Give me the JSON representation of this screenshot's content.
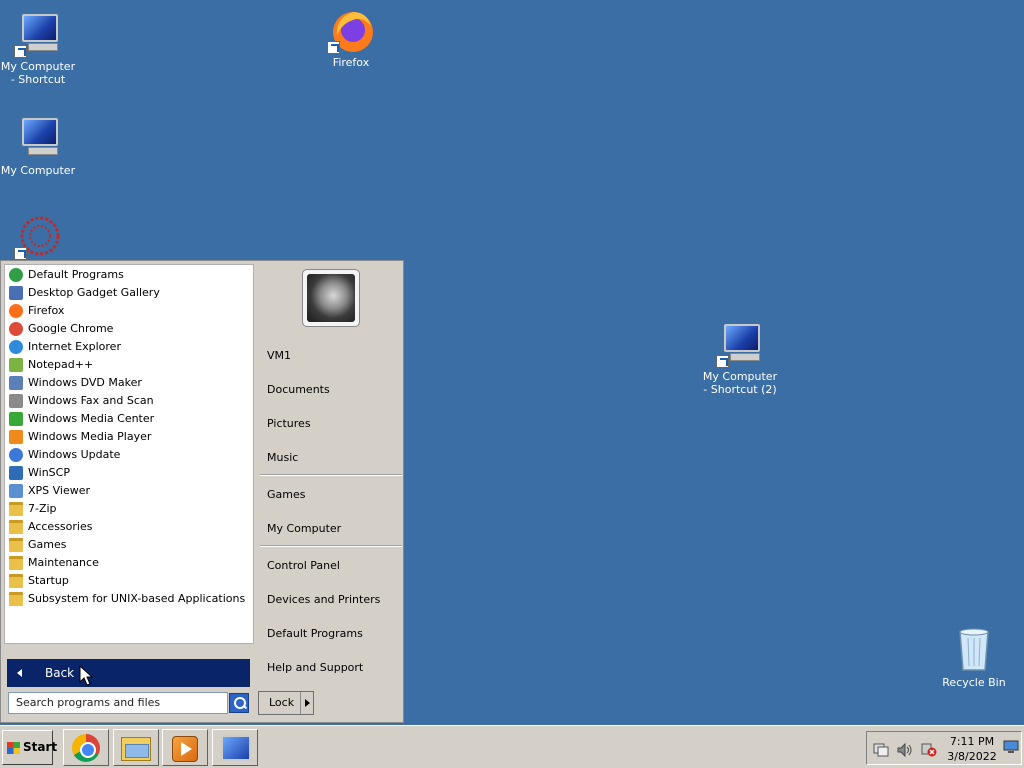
{
  "desktop": {
    "icons": [
      {
        "label": "My Computer - Shortcut"
      },
      {
        "label": "Firefox"
      },
      {
        "label": "My Computer"
      },
      {
        "label": "My Computer - Shortcut (2)"
      },
      {
        "label": "Recycle Bin"
      }
    ]
  },
  "start_menu": {
    "programs": [
      {
        "label": "Default Programs",
        "icon": "default-programs-icon"
      },
      {
        "label": "Desktop Gadget Gallery",
        "icon": "gadget-gallery-icon"
      },
      {
        "label": "Firefox",
        "icon": "firefox-icon"
      },
      {
        "label": "Google Chrome",
        "icon": "chrome-icon"
      },
      {
        "label": "Internet Explorer",
        "icon": "internet-explorer-icon"
      },
      {
        "label": "Notepad++",
        "icon": "notepadpp-icon"
      },
      {
        "label": "Windows DVD Maker",
        "icon": "dvd-maker-icon"
      },
      {
        "label": "Windows Fax and Scan",
        "icon": "fax-scan-icon"
      },
      {
        "label": "Windows Media Center",
        "icon": "media-center-icon"
      },
      {
        "label": "Windows Media Player",
        "icon": "media-player-icon"
      },
      {
        "label": "Windows Update",
        "icon": "windows-update-icon"
      },
      {
        "label": "WinSCP",
        "icon": "winscp-icon"
      },
      {
        "label": "XPS Viewer",
        "icon": "xps-viewer-icon"
      },
      {
        "label": "7-Zip",
        "icon": "folder-icon"
      },
      {
        "label": "Accessories",
        "icon": "folder-icon"
      },
      {
        "label": "Games",
        "icon": "folder-icon"
      },
      {
        "label": "Maintenance",
        "icon": "folder-icon"
      },
      {
        "label": "Startup",
        "icon": "folder-icon"
      },
      {
        "label": "Subsystem for UNIX-based Applications",
        "icon": "folder-icon"
      }
    ],
    "back_label": "Back",
    "search_placeholder": "Search programs and files",
    "places": {
      "user": "VM1",
      "documents": "Documents",
      "pictures": "Pictures",
      "music": "Music",
      "games": "Games",
      "my_computer": "My Computer",
      "control_panel": "Control Panel",
      "devices_printers": "Devices and Printers",
      "default_programs": "Default Programs",
      "help_support": "Help and Support"
    },
    "lock_label": "Lock"
  },
  "taskbar": {
    "start_label": "Start",
    "pinned": [
      "chrome-icon",
      "windows-explorer-icon",
      "media-player-icon",
      "network-icon"
    ],
    "clock_time": "7:11 PM",
    "clock_date": "3/8/2022"
  },
  "colors": {
    "desktop": "#3a6ea5",
    "selection": "#0a246a",
    "menu_face": "#d4d0c8"
  }
}
